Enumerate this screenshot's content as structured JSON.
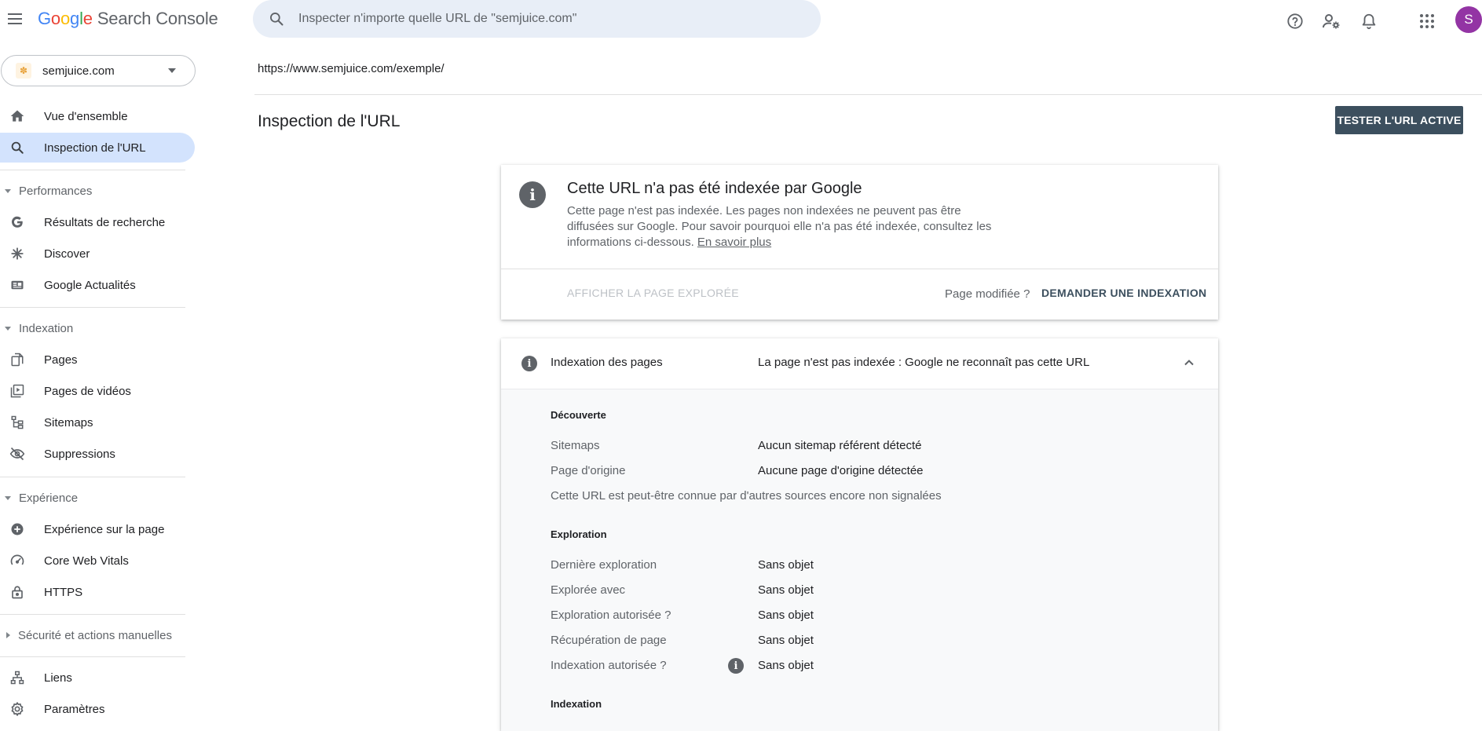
{
  "app": {
    "logo": {
      "G": "G",
      "o1": "o",
      "o2": "o",
      "g": "g",
      "l": "l",
      "e": "e",
      "product": "Search Console"
    },
    "search_placeholder": "Inspecter n'importe quelle URL de \"semjuice.com\"",
    "avatar_letter": "S",
    "colors": {
      "accent": "#3c4f5e",
      "active_nav": "#d3e3fd",
      "search_bg": "#e8eef7",
      "avatar": "#9334a4"
    }
  },
  "sidebar": {
    "property": "semjuice.com",
    "items": [
      {
        "label": "Vue d'ensemble",
        "icon": "home-icon"
      },
      {
        "label": "Inspection de l'URL",
        "icon": "search-icon",
        "active": true
      }
    ],
    "performances": {
      "label": "Performances",
      "items": [
        {
          "label": "Résultats de recherche",
          "icon": "google-g-icon"
        },
        {
          "label": "Discover",
          "icon": "asterisk-icon"
        },
        {
          "label": "Google Actualités",
          "icon": "news-icon"
        }
      ]
    },
    "indexation": {
      "label": "Indexation",
      "items": [
        {
          "label": "Pages",
          "icon": "pages-icon"
        },
        {
          "label": "Pages de vidéos",
          "icon": "video-pages-icon"
        },
        {
          "label": "Sitemaps",
          "icon": "sitemap-icon"
        },
        {
          "label": "Suppressions",
          "icon": "visibility-off-icon"
        }
      ]
    },
    "experience": {
      "label": "Expérience",
      "items": [
        {
          "label": "Expérience sur la page",
          "icon": "add-circle-icon"
        },
        {
          "label": "Core Web Vitals",
          "icon": "speed-icon"
        },
        {
          "label": "HTTPS",
          "icon": "lock-icon"
        }
      ]
    },
    "security": {
      "label": "Sécurité et actions manuelles"
    },
    "bottom": [
      {
        "label": "Liens",
        "icon": "links-icon"
      },
      {
        "label": "Paramètres",
        "icon": "settings-icon"
      }
    ]
  },
  "main": {
    "url": "https://www.semjuice.com/exemple/",
    "title": "Inspection de l'URL",
    "test_button": "TESTER L'URL ACTIVE",
    "status_card": {
      "heading": "Cette URL n'a pas été indexée par Google",
      "description": "Cette page n'est pas indexée. Les pages non indexées ne peuvent pas être diffusées sur Google. Pour savoir pourquoi elle n'a pas été indexée, consultez les informations ci-dessous.",
      "learn_more": "En savoir plus",
      "view_crawled": "AFFICHER LA PAGE EXPLORÉE",
      "page_modified": "Page modifiée ?",
      "request_indexing": "DEMANDER UNE INDEXATION"
    },
    "indexing_card": {
      "title": "Indexation des pages",
      "status": "La page n'est pas indexée : Google ne reconnaît pas cette URL",
      "discovery": {
        "heading": "Découverte",
        "rows": [
          {
            "label": "Sitemaps",
            "value": "Aucun sitemap référent détecté"
          },
          {
            "label": "Page d'origine",
            "value": "Aucune page d'origine détectée"
          }
        ],
        "note": "Cette URL est peut-être connue par d'autres sources encore non signalées"
      },
      "crawl": {
        "heading": "Exploration",
        "rows": [
          {
            "label": "Dernière exploration",
            "value": "Sans objet"
          },
          {
            "label": "Explorée avec",
            "value": "Sans objet"
          },
          {
            "label": "Exploration autorisée ?",
            "value": "Sans objet"
          },
          {
            "label": "Récupération de page",
            "value": "Sans objet"
          },
          {
            "label": "Indexation autorisée ?",
            "value": "Sans objet"
          }
        ]
      },
      "indexing": {
        "heading": "Indexation"
      }
    }
  }
}
